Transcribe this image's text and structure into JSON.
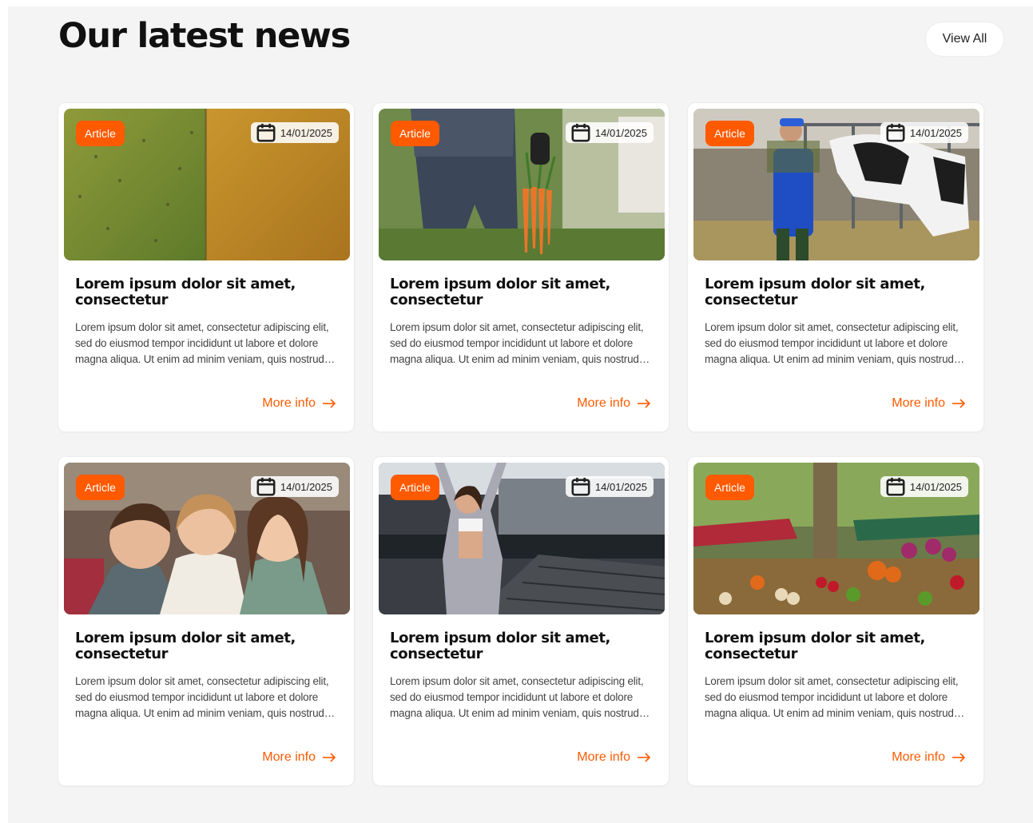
{
  "header": {
    "title": "Our latest news",
    "view_all_label": "View All"
  },
  "colors": {
    "accent": "#ff5a00",
    "background": "#f4f4f4",
    "card": "#ffffff"
  },
  "cards": [
    {
      "tag": "Article",
      "date": "14/01/2025",
      "image": "aerial-fields-photo",
      "title": "Lorem ipsum dolor sit amet, consectetur",
      "text": "Lorem ipsum dolor sit amet, consectetur adipiscing elit, sed do eiusmod tempor incididunt ut labore et dolore magna aliqua. Ut enim ad minim veniam, quis nostrud exercitation",
      "more_label": "More info"
    },
    {
      "tag": "Article",
      "date": "14/01/2025",
      "image": "carrots-harvest-photo",
      "title": "Lorem ipsum dolor sit amet, consectetur",
      "text": "Lorem ipsum dolor sit amet, consectetur adipiscing elit, sed do eiusmod tempor incididunt ut labore et dolore magna aliqua. Ut enim ad minim veniam, quis nostrud exercitation",
      "more_label": "More info"
    },
    {
      "tag": "Article",
      "date": "14/01/2025",
      "image": "dairy-farmer-cow-photo",
      "title": "Lorem ipsum dolor sit amet, consectetur",
      "text": "Lorem ipsum dolor sit amet, consectetur adipiscing elit, sed do eiusmod tempor incididunt ut labore et dolore magna aliqua. Ut enim ad minim veniam, quis nostrud exercitation",
      "more_label": "More info"
    },
    {
      "tag": "Article",
      "date": "14/01/2025",
      "image": "three-children-photo",
      "title": "Lorem ipsum dolor sit amet, consectetur",
      "text": "Lorem ipsum dolor sit amet, consectetur adipiscing elit, sed do eiusmod tempor incididunt ut labore et dolore magna aliqua. Ut enim ad minim veniam, quis nostrud exercitation",
      "more_label": "More info"
    },
    {
      "tag": "Article",
      "date": "14/01/2025",
      "image": "woman-stretching-photo",
      "title": "Lorem ipsum dolor sit amet, consectetur",
      "text": "Lorem ipsum dolor sit amet, consectetur adipiscing elit, sed do eiusmod tempor incididunt ut labore et dolore magna aliqua. Ut enim ad minim veniam, quis nostrud exercitation",
      "more_label": "More info"
    },
    {
      "tag": "Article",
      "date": "14/01/2025",
      "image": "market-stalls-photo",
      "title": "Lorem ipsum dolor sit amet, consectetur",
      "text": "Lorem ipsum dolor sit amet, consectetur adipiscing elit, sed do eiusmod tempor incididunt ut labore et dolore magna aliqua. Ut enim ad minim veniam, quis nostrud exercitation",
      "more_label": "More info"
    }
  ]
}
